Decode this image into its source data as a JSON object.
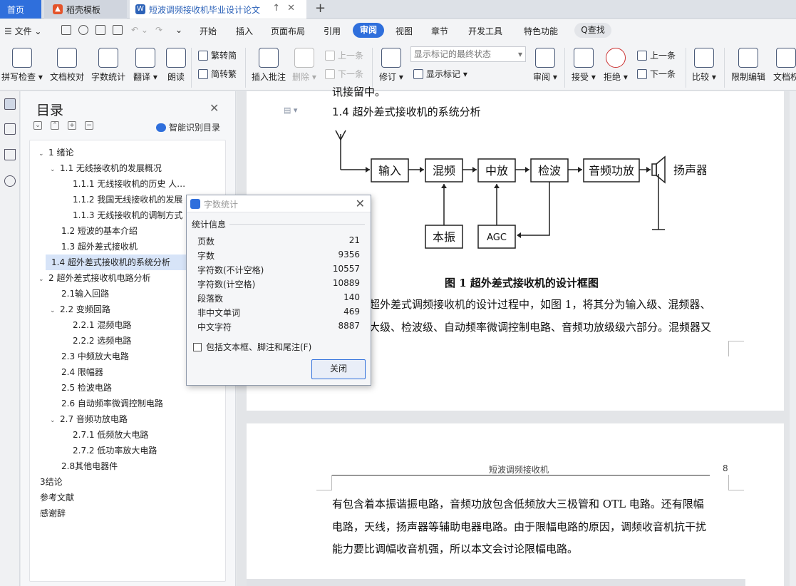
{
  "tabs": {
    "home": "首页",
    "daoke": "稻壳模板",
    "doc": "短波调频接收机毕业设计论文",
    "new": "+"
  },
  "menu": {
    "file": "文件",
    "items": [
      "开始",
      "插入",
      "页面布局",
      "引用",
      "审阅",
      "视图",
      "章节",
      "开发工具",
      "特色功能"
    ],
    "active": "审阅",
    "search": "Q查找"
  },
  "ribbon": {
    "spell": "拼写检查",
    "proof": "文档校对",
    "wordcount": "字数统计",
    "translate": "翻译",
    "read": "朗读",
    "trad": "繁转简",
    "simp": "简转繁",
    "comment": "插入批注",
    "delete": "删除",
    "prev_c": "上一条",
    "next_c": "下一条",
    "revise": "修订",
    "markmode": "显示标记的最终状态",
    "showmark": "显示标记",
    "review": "审阅",
    "accept": "接受",
    "reject": "拒绝",
    "prev": "上一条",
    "next": "下一条",
    "compare": "比较",
    "restrict": "限制编辑",
    "docperm": "文档权"
  },
  "toc": {
    "title": "目录",
    "ai_label": "智能识别目录",
    "items": [
      {
        "text": "1  绪论",
        "arrow": "⌄"
      },
      {
        "text": "1.1  无线接收机的发展概况",
        "arrow": "⌄"
      },
      {
        "text": "1.1.1  无线接收机的历史      人…",
        "arrow": ""
      },
      {
        "text": "1.1.2  我国无线接收机的发展",
        "arrow": ""
      },
      {
        "text": "1.1.3  无线接收机的调制方式",
        "arrow": ""
      },
      {
        "text": "1.2  短波的基本介绍",
        "arrow": ""
      },
      {
        "text": "1.3  超外差式接收机",
        "arrow": ""
      },
      {
        "text": "1.4  超外差式接收机的系统分析",
        "arrow": ""
      },
      {
        "text": "2  超外差式接收机电路分析",
        "arrow": "⌄"
      },
      {
        "text": "2.1输入回路",
        "arrow": ""
      },
      {
        "text": "2.2  变频回路",
        "arrow": "⌄"
      },
      {
        "text": "2.2.1  混频电路",
        "arrow": ""
      },
      {
        "text": "2.2.2  选频电路",
        "arrow": ""
      },
      {
        "text": "2.3  中频放大电路",
        "arrow": ""
      },
      {
        "text": "2.4  限幅器",
        "arrow": ""
      },
      {
        "text": "2.5  检波电路",
        "arrow": ""
      },
      {
        "text": "2.6  自动频率微调控制电路",
        "arrow": ""
      },
      {
        "text": "2.7  音频功放电路",
        "arrow": "⌄"
      },
      {
        "text": "2.7.1  低频放大电路",
        "arrow": ""
      },
      {
        "text": "2.7.2  低功率放大电路",
        "arrow": ""
      },
      {
        "text": "2.8其他电器件",
        "arrow": ""
      },
      {
        "text": "3结论",
        "arrow": ""
      },
      {
        "text": "参考文献",
        "arrow": ""
      },
      {
        "text": "感谢辞",
        "arrow": ""
      }
    ]
  },
  "page1": {
    "top_fragment": "讯接留中。",
    "heading": "1.4   超外差式接收机的系统分析",
    "blocks": {
      "input": "输入",
      "mixer": "混频",
      "if": "中放",
      "detect": "检波",
      "audio": "音频功放",
      "speaker": "扬声器",
      "lo": "本振",
      "agc": "AGC"
    },
    "caption": "图 1   超外差式接收机的设计框图",
    "para1": "超外差式调频接收机的设计过程中，如图 1，将其分为输入级、混频器、",
    "para2": "大级、检波级、自动频率微调控制电路、音频功放级级六部分。混频器又"
  },
  "page2": {
    "header": "短波调频接收机",
    "pagenum": "8",
    "lines": [
      "有包含着本振谐振电路，音频功放包含低频放大三极管和 OTL 电路。还有限幅",
      "电路，天线，扬声器等辅助电器电路。由于限幅电路的原因，调频收音机抗干扰",
      "能力要比调幅收音机强，所以本文会讨论限幅电路。"
    ]
  },
  "dialog": {
    "title": "字数统计",
    "section": "统计信息",
    "stats": [
      {
        "label": "页数",
        "value": "21"
      },
      {
        "label": "字数",
        "value": "9356"
      },
      {
        "label": "字符数(不计空格)",
        "value": "10557"
      },
      {
        "label": "字符数(计空格)",
        "value": "10889"
      },
      {
        "label": "段落数",
        "value": "140"
      },
      {
        "label": "非中文单词",
        "value": "469"
      },
      {
        "label": "中文字符",
        "value": "8887"
      }
    ],
    "checkbox": "包括文本框、脚注和尾注(F)",
    "close": "关闭"
  },
  "colors": {
    "accent": "#2f6fdc",
    "selected": "#d7e4f8"
  }
}
